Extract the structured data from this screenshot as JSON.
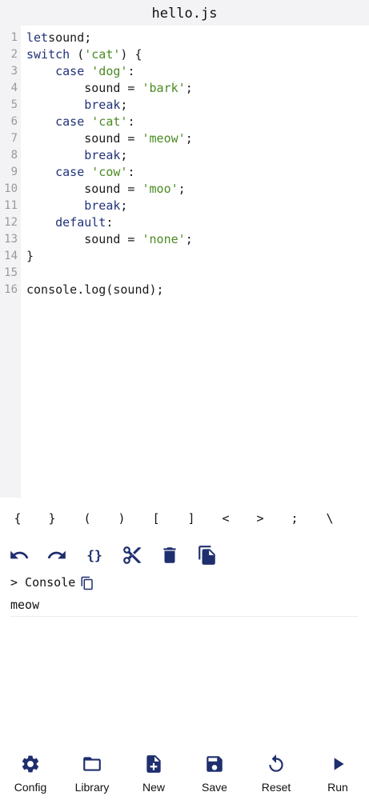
{
  "header": {
    "title": "hello.js"
  },
  "editor": {
    "lines": [
      {
        "num": "1",
        "tokens": [
          [
            "kw",
            "let"
          ],
          [
            "",
            "sound;"
          ]
        ]
      },
      {
        "num": "2",
        "tokens": [
          [
            "kw",
            "switch"
          ],
          [
            "",
            " ("
          ],
          [
            "str",
            "'cat'"
          ],
          [
            "",
            ") {"
          ]
        ]
      },
      {
        "num": "3",
        "tokens": [
          [
            "",
            "    "
          ],
          [
            "kw",
            "case"
          ],
          [
            "",
            " "
          ],
          [
            "str",
            "'dog'"
          ],
          [
            "",
            ":"
          ]
        ]
      },
      {
        "num": "4",
        "tokens": [
          [
            "",
            "        sound = "
          ],
          [
            "str",
            "'bark'"
          ],
          [
            "",
            ";"
          ]
        ]
      },
      {
        "num": "5",
        "tokens": [
          [
            "",
            "        "
          ],
          [
            "kw",
            "break"
          ],
          [
            "",
            ";"
          ]
        ]
      },
      {
        "num": "6",
        "tokens": [
          [
            "",
            "    "
          ],
          [
            "kw",
            "case"
          ],
          [
            "",
            " "
          ],
          [
            "str",
            "'cat'"
          ],
          [
            "",
            ":"
          ]
        ]
      },
      {
        "num": "7",
        "tokens": [
          [
            "",
            "        sound = "
          ],
          [
            "str",
            "'meow'"
          ],
          [
            "",
            ";"
          ]
        ]
      },
      {
        "num": "8",
        "tokens": [
          [
            "",
            "        "
          ],
          [
            "kw",
            "break"
          ],
          [
            "",
            ";"
          ]
        ]
      },
      {
        "num": "9",
        "tokens": [
          [
            "",
            "    "
          ],
          [
            "kw",
            "case"
          ],
          [
            "",
            " "
          ],
          [
            "str",
            "'cow'"
          ],
          [
            "",
            ":"
          ]
        ]
      },
      {
        "num": "10",
        "tokens": [
          [
            "",
            "        sound = "
          ],
          [
            "str",
            "'moo'"
          ],
          [
            "",
            ";"
          ]
        ]
      },
      {
        "num": "11",
        "tokens": [
          [
            "",
            "        "
          ],
          [
            "kw",
            "break"
          ],
          [
            "",
            ";"
          ]
        ]
      },
      {
        "num": "12",
        "tokens": [
          [
            "",
            "    "
          ],
          [
            "kw",
            "default"
          ],
          [
            "",
            ":"
          ]
        ]
      },
      {
        "num": "13",
        "tokens": [
          [
            "",
            "        sound = "
          ],
          [
            "str",
            "'none'"
          ],
          [
            "",
            ";"
          ]
        ]
      },
      {
        "num": "14",
        "tokens": [
          [
            "",
            "}"
          ]
        ]
      },
      {
        "num": "15",
        "tokens": []
      },
      {
        "num": "16",
        "tokens": [
          [
            "",
            "console.log(sound);"
          ]
        ]
      }
    ]
  },
  "keys": [
    "{",
    "}",
    "(",
    ")",
    "[",
    "]",
    "<",
    ">",
    ";",
    "\\"
  ],
  "toolbar": {
    "icons": [
      "undo-icon",
      "redo-icon",
      "braces-icon",
      "scissors-icon",
      "trash-icon",
      "copy-file-icon"
    ]
  },
  "console": {
    "label": "> Console",
    "output": "meow"
  },
  "nav": {
    "items": [
      {
        "label": "Config",
        "icon": "gear-icon"
      },
      {
        "label": "Library",
        "icon": "folder-icon"
      },
      {
        "label": "New",
        "icon": "new-file-icon"
      },
      {
        "label": "Save",
        "icon": "save-icon"
      },
      {
        "label": "Reset",
        "icon": "reset-icon"
      },
      {
        "label": "Run",
        "icon": "play-icon"
      }
    ]
  },
  "colors": {
    "accent": "#1f2e6e",
    "keyword": "#22327a",
    "string": "#4a8a22",
    "gutter_bg": "#f3f3f5"
  }
}
